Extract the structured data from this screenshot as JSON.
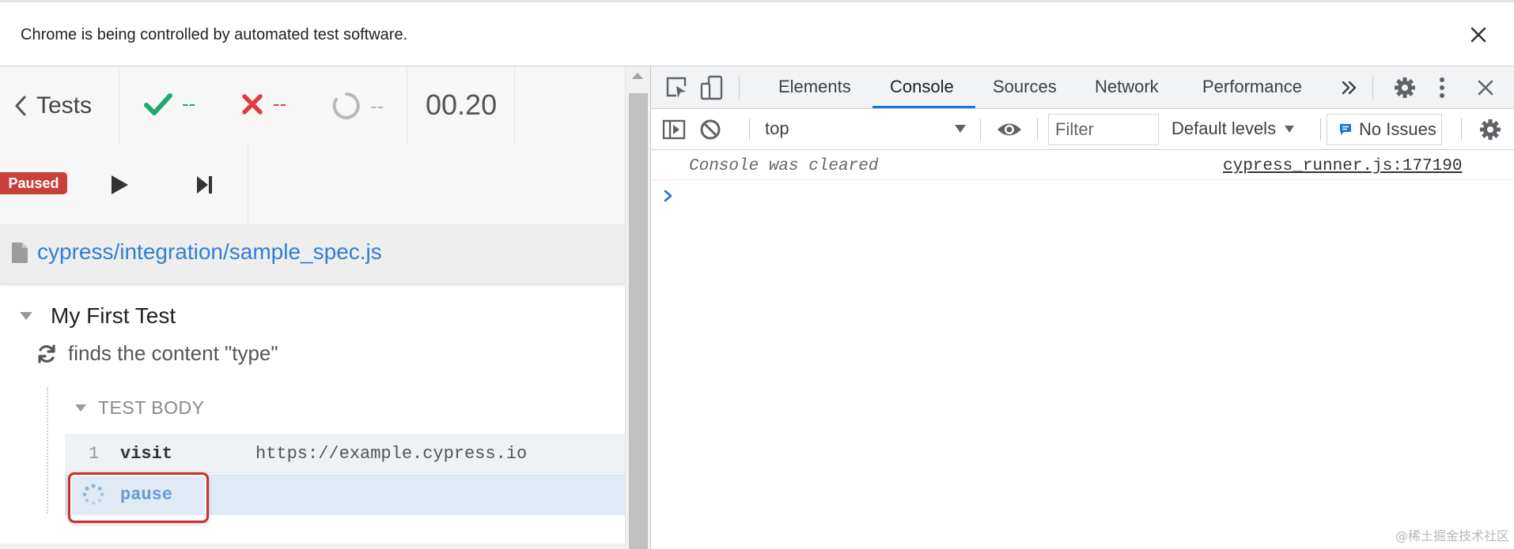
{
  "infobar": {
    "message": "Chrome is being controlled by automated test software."
  },
  "runner": {
    "tests_label": "Tests",
    "passed": "--",
    "failed": "--",
    "pending": "--",
    "duration": "00.20",
    "paused_label": "Paused",
    "spec_path": "cypress/integration/sample_spec.js",
    "suite_title": "My First Test",
    "test_title": "finds the content \"type\"",
    "hook_label": "TEST BODY",
    "commands": [
      {
        "number": "1",
        "name": "visit",
        "message": "https://example.cypress.io"
      },
      {
        "number": "",
        "name": "pause",
        "message": ""
      }
    ]
  },
  "devtools": {
    "tabs": [
      "Elements",
      "Console",
      "Sources",
      "Network",
      "Performance"
    ],
    "active_tab": "Console",
    "context": "top",
    "filter_placeholder": "Filter",
    "levels": "Default levels",
    "issues": "No Issues",
    "console": {
      "message": "Console was cleared",
      "source": "cypress_runner.js:177190"
    }
  },
  "watermark": "@稀土掘金技术社区",
  "colors": {
    "pass": "#1fa971",
    "fail": "#e03c3c",
    "link": "#2f7fd6",
    "paused": "#c8403b",
    "highlight": "#d12d2d",
    "devtools_accent": "#1a73e8"
  }
}
